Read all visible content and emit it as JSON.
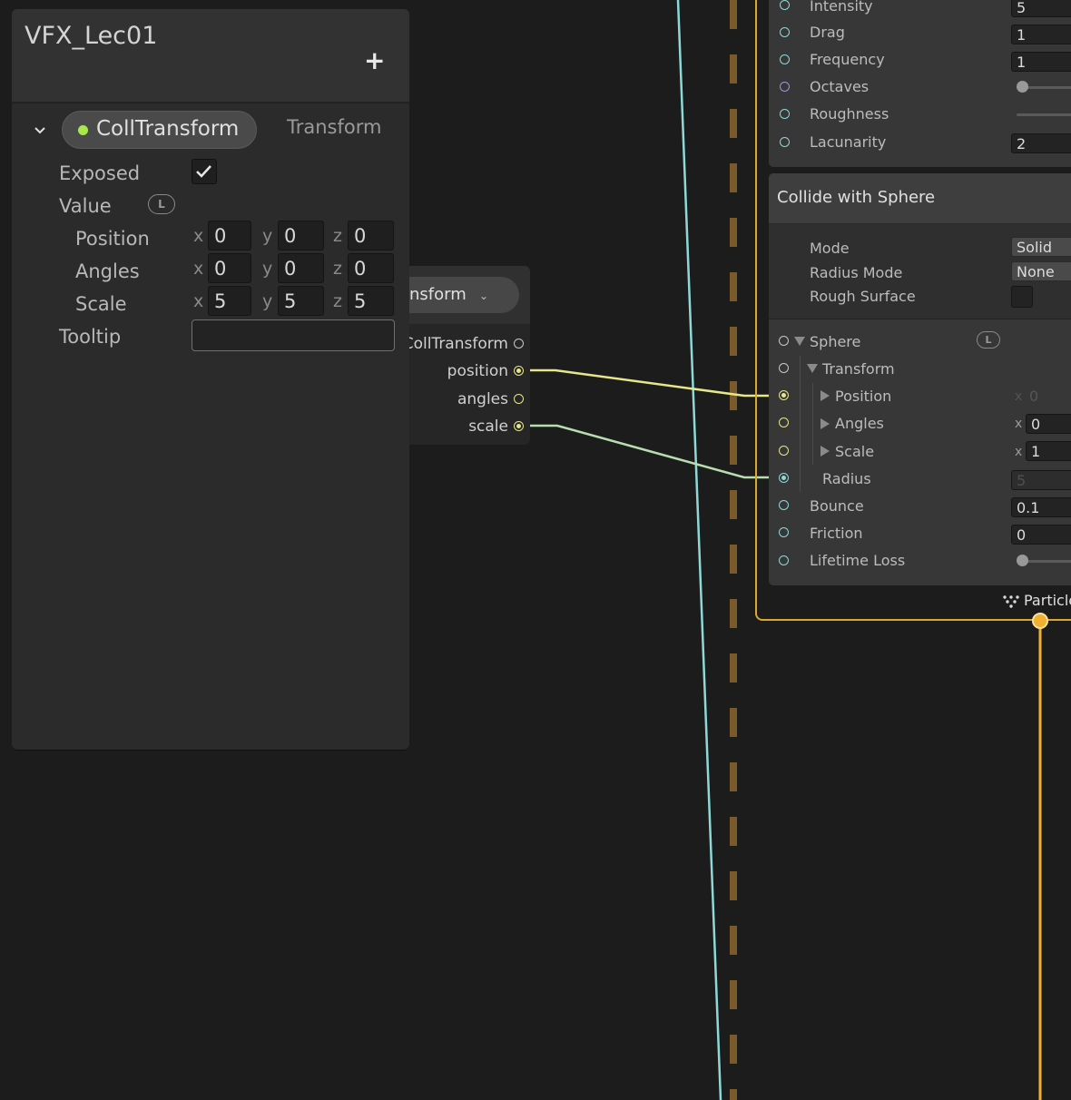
{
  "blackboard": {
    "title": "VFX_Lec01",
    "add_label": "+",
    "property": {
      "name": "CollTransform",
      "type": "Transform",
      "exposed_label": "Exposed",
      "exposed": true,
      "value_label": "Value",
      "value_badge": "L",
      "position_label": "Position",
      "angles_label": "Angles",
      "scale_label": "Scale",
      "axes": [
        "x",
        "y",
        "z"
      ],
      "position": [
        "0",
        "0",
        "0"
      ],
      "angles": [
        "0",
        "0",
        "0"
      ],
      "scale": [
        "5",
        "5",
        "5"
      ],
      "tooltip_label": "Tooltip",
      "tooltip_value": ""
    }
  },
  "parameter_node": {
    "title_partial": "nsform",
    "ports": [
      {
        "label": "CollTransform"
      },
      {
        "label": "position"
      },
      {
        "label": "angles"
      },
      {
        "label": "scale"
      }
    ]
  },
  "noise_block": {
    "rows": [
      {
        "label": "Intensity",
        "value": "5"
      },
      {
        "label": "Drag",
        "value": "1"
      },
      {
        "label": "Frequency",
        "value": "1"
      },
      {
        "label": "Octaves",
        "value": ""
      },
      {
        "label": "Roughness",
        "value": ""
      },
      {
        "label": "Lacunarity",
        "value": "2"
      }
    ]
  },
  "collide_block": {
    "title": "Collide with Sphere",
    "settings": {
      "mode_label": "Mode",
      "mode_value": "Solid",
      "radius_mode_label": "Radius Mode",
      "radius_mode_value": "None",
      "rough_surface_label": "Rough Surface"
    },
    "sphere_label": "Sphere",
    "sphere_badge": "L",
    "transform_label": "Transform",
    "position_label": "Position",
    "position_x_axis": "x",
    "position_x": "0",
    "angles_label": "Angles",
    "angles_x_axis": "x",
    "angles_x": "0",
    "scale_label": "Scale",
    "scale_x_axis": "x",
    "scale_x": "1",
    "radius_label": "Radius",
    "radius_value": "5",
    "bounce_label": "Bounce",
    "bounce_value": "0.1",
    "friction_label": "Friction",
    "friction_value": "0",
    "lifetime_loss_label": "Lifetime Loss"
  },
  "flow_output_label": "Particle",
  "colors": {
    "context_border": "#d8a830",
    "wire_yellow": "#e6e68a",
    "wire_cyan": "#8fd8d8",
    "flow_dashed": "#7a5a2a",
    "exposed_dot": "#a8e84a"
  }
}
